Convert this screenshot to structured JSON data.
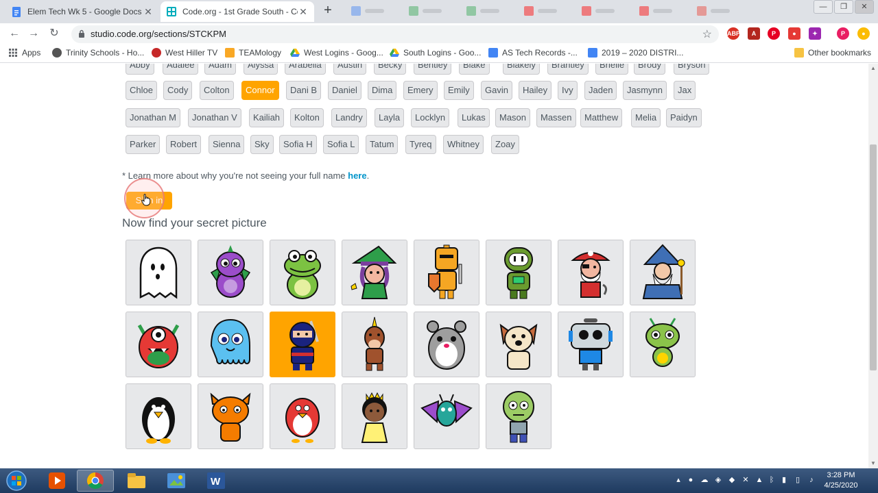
{
  "browser": {
    "tabs": [
      {
        "title": "Elem Tech Wk 5 - Google Docs",
        "active": false
      },
      {
        "title": "Code.org - 1st Grade South - Co",
        "active": true
      }
    ],
    "url": "studio.code.org/sections/STCKPM"
  },
  "bookmarks": [
    {
      "label": "Apps",
      "icon": "apps-icon"
    },
    {
      "label": "Trinity Schools - Ho...",
      "icon": "trinity-icon"
    },
    {
      "label": "West Hiller TV",
      "icon": "whtv-icon"
    },
    {
      "label": "TEAMology",
      "icon": "teamology-icon"
    },
    {
      "label": "West Logins - Goog...",
      "icon": "drive-icon"
    },
    {
      "label": "South Logins - Goo...",
      "icon": "drive-icon"
    },
    {
      "label": "AS Tech Records -...",
      "icon": "docs-icon"
    },
    {
      "label": "2019 – 2020 DISTRI...",
      "icon": "docs-icon"
    },
    {
      "label": "Other bookmarks",
      "icon": "folder-icon"
    }
  ],
  "names": {
    "row_partial": [
      "Abby",
      "Adalee",
      "Adam",
      "Alyssa",
      "Arabella",
      "Austin",
      "Becky",
      "Bentley",
      "Blake",
      "Blakely",
      "Brantley",
      "Brielle",
      "Brody",
      "Bryson"
    ],
    "rows": [
      [
        "Chloe",
        "Cody",
        "Colton",
        "Connor",
        "Dani B",
        "Daniel",
        "Dima",
        "Emery",
        "Emily",
        "Gavin",
        "Hailey",
        "Ivy",
        "Jaden",
        "Jasmynn",
        "Jax"
      ],
      [
        "Jonathan M",
        "Jonathan V",
        "Kailiah",
        "Kolton",
        "Landry",
        "Layla",
        "Locklyn",
        "Lukas",
        "Mason",
        "Massen",
        "Matthew",
        "Melia",
        "Paidyn"
      ],
      [
        "Parker",
        "Robert",
        "Sienna",
        "Sky",
        "Sofia H",
        "Sofia L",
        "Tatum",
        "Tyreq",
        "Whitney",
        "Zoay"
      ]
    ],
    "selected": "Connor"
  },
  "note": {
    "prefix": "* Learn more about why you're not seeing your full name ",
    "link": "here",
    "suffix": "."
  },
  "signin_label": "Sign in",
  "secret_heading": "Now find your secret picture",
  "pictures": [
    {
      "name": "ghost-picture",
      "selected": false
    },
    {
      "name": "dragon-picture",
      "selected": false
    },
    {
      "name": "frog-picture",
      "selected": false
    },
    {
      "name": "witch-picture",
      "selected": false
    },
    {
      "name": "knight-picture",
      "selected": false
    },
    {
      "name": "robot-picture",
      "selected": false
    },
    {
      "name": "pirate-picture",
      "selected": false
    },
    {
      "name": "wizard-picture",
      "selected": false
    },
    {
      "name": "monster-picture",
      "selected": false
    },
    {
      "name": "octopus-picture",
      "selected": false
    },
    {
      "name": "ninja-picture",
      "selected": true
    },
    {
      "name": "unicorn-picture",
      "selected": false
    },
    {
      "name": "hamster-picture",
      "selected": false
    },
    {
      "name": "dog-picture",
      "selected": false
    },
    {
      "name": "bot-picture",
      "selected": false
    },
    {
      "name": "alien-picture",
      "selected": false
    },
    {
      "name": "penguin-picture",
      "selected": false
    },
    {
      "name": "cat-picture",
      "selected": false
    },
    {
      "name": "bird-picture",
      "selected": false
    },
    {
      "name": "princess-picture",
      "selected": false
    },
    {
      "name": "bat-picture",
      "selected": false
    },
    {
      "name": "zombie-picture",
      "selected": false
    }
  ],
  "taskbar": {
    "time": "3:28 PM",
    "date": "4/25/2020"
  },
  "colors": {
    "accent": "#ffa400",
    "link": "#0094ca",
    "button_bg": "#e7e8ea",
    "text": "#4d575f"
  }
}
